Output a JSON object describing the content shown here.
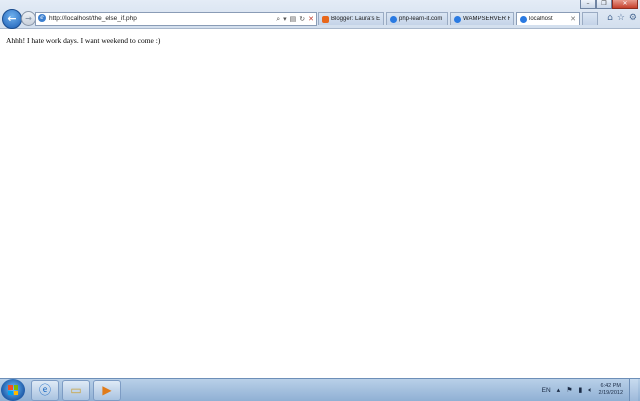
{
  "browser": {
    "address_url": "http://localhost/the_else_if.php",
    "tabs": [
      {
        "label": "Blogger: Laura's E...",
        "active": false,
        "icon_color": "#e8671b"
      },
      {
        "label": "php-learn-it.com",
        "active": false,
        "icon_color": "#2a7ae2"
      },
      {
        "label": "WAMPSERVER H...",
        "active": false,
        "icon_color": "#2a7ae2"
      },
      {
        "label": "localhost",
        "active": true,
        "icon_color": "#2a7ae2"
      }
    ],
    "icons": {
      "back": "back-arrow-icon",
      "forward": "forward-arrow-icon",
      "search": "search-icon",
      "dropdown": "dropdown-icon",
      "compatibility": "compatibility-view-icon",
      "refresh": "refresh-icon",
      "stop": "stop-icon",
      "home": "home-icon",
      "favorites": "star-icon",
      "tools": "gear-icon"
    }
  },
  "page": {
    "text": "Ahhh! I hate work days. I want weekend to come :)"
  },
  "taskbar": {
    "language": "EN",
    "clock_time": "6:42 PM",
    "clock_date": "2/19/2012"
  }
}
